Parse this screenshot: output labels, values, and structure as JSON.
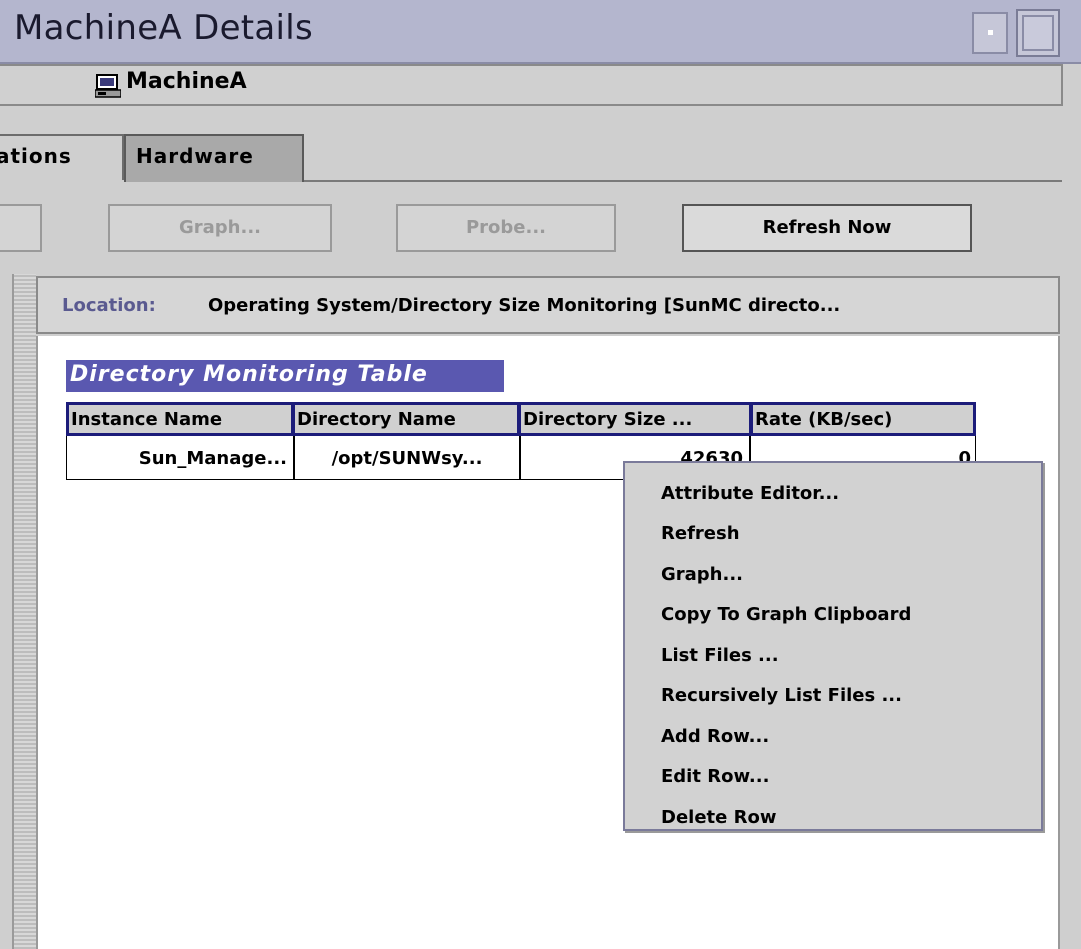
{
  "window": {
    "title": "MachineA Details"
  },
  "header": {
    "host_name": "MachineA"
  },
  "tabs": [
    {
      "label": "ations"
    },
    {
      "label": "Hardware"
    }
  ],
  "toolbar": {
    "graph_label": "Graph...",
    "probe_label": "Probe...",
    "refresh_label": "Refresh Now"
  },
  "location": {
    "label": "Location:",
    "value": "Operating System/Directory Size Monitoring [SunMC directo..."
  },
  "table": {
    "title": "Directory Monitoring Table",
    "columns": [
      "Instance Name",
      "Directory Name",
      "Directory Size ...",
      "Rate (KB/sec)"
    ],
    "rows": [
      [
        "Sun_Manage...",
        "/opt/SUNWsy...",
        "42630",
        "0"
      ]
    ]
  },
  "context_menu": {
    "items": [
      "Attribute Editor...",
      "Refresh",
      "Graph...",
      "Copy To Graph Clipboard",
      "List Files ...",
      "Recursively List Files ...",
      "Add Row...",
      "Edit Row...",
      "Delete Row"
    ]
  },
  "colors": {
    "titlebar": "#b4b6ce",
    "table_title_bg": "#5a58b0",
    "header_border": "#1c1c7a",
    "location_label": "#5a5a90"
  }
}
